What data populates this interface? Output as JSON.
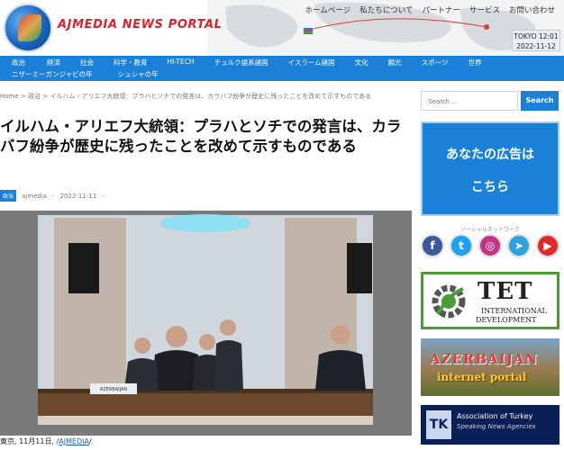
{
  "header": {
    "logo_text": "AJMEDIA NEWS PORTAL",
    "topnav": [
      "ホームページ",
      "私たちについて",
      "パートナー",
      "サービス",
      "お問い合わせ"
    ],
    "clock": {
      "city": "TOKYO 12:01",
      "date": "2022-11-12"
    }
  },
  "catnav": {
    "row1": [
      "政治",
      "経済",
      "社会",
      "科学・教育",
      "HI-TECH",
      "チュルク語系諸国",
      "イスラーム諸国",
      "文化",
      "観光",
      "スポーツ",
      "世界"
    ],
    "row2": [
      "ニザーミーガンジャビの年",
      "シュシャの年"
    ]
  },
  "breadcrumb": {
    "home": "Home",
    "sep": ">",
    "category": "政治",
    "current": "イルハム・アリエフ大統領：プラハとソチでの発言は、カラバフ紛争が歴史に残ったことを改めて示すものである"
  },
  "article": {
    "title": "イルハム・アリエフ大統領：プラハとソチでの発言は、カラバフ紛争が歴史に残ったことを改めて示すものである",
    "badge": "政治",
    "author": "ajmedia",
    "date": "2022-11-11",
    "date_sep": "-",
    "photo": {
      "nameplate": "AZERBAIJAN"
    },
    "caption_prefix": "東京, 11月11日, /",
    "caption_link": "AJMEDIA",
    "caption_suffix": "/"
  },
  "sidebar": {
    "search_placeholder": "Search ...",
    "search_button": "Search",
    "ad_line1": "あなたの広告は",
    "ad_line2": "こちら",
    "social_label": "ソーシャルネットワーク",
    "social": [
      {
        "name": "facebook",
        "glyph": "f",
        "color": "#3b5998"
      },
      {
        "name": "twitter",
        "glyph": "t",
        "color": "#1da1f2"
      },
      {
        "name": "instagram",
        "glyph": "◎",
        "color": "#c13584"
      },
      {
        "name": "telegram",
        "glyph": "➤",
        "color": "#2aa3df"
      },
      {
        "name": "youtube",
        "glyph": "▶",
        "color": "#e02a2a"
      }
    ],
    "tet": {
      "big": "TET",
      "line1": "INTERNATIONAL",
      "line2": "DEVELOPMENT"
    },
    "az": {
      "line1": "AZERBAIJAN",
      "line2": "internet portal"
    },
    "tk": {
      "logo": "TK",
      "line1": "Association of Turkey",
      "line2": "Speaking News Agencies"
    }
  }
}
